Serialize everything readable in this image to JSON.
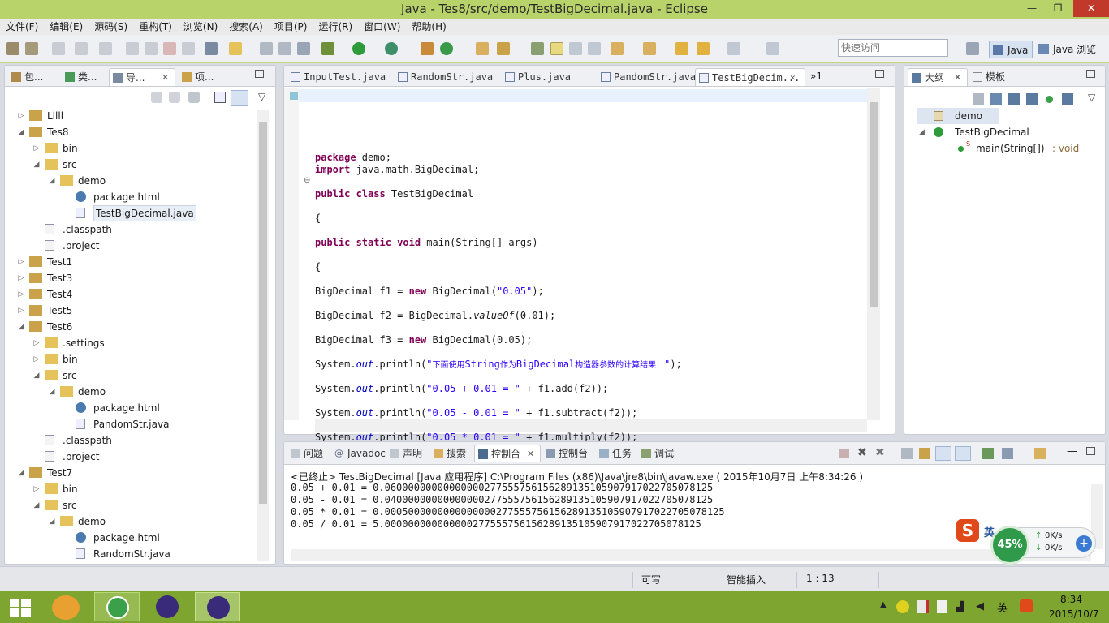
{
  "window": {
    "title": "Java - Tes8/src/demo/TestBigDecimal.java - Eclipse",
    "min": "—",
    "max": "❐",
    "close": "✕"
  },
  "menu": [
    "文件(F)",
    "编辑(E)",
    "源码(S)",
    "重构(T)",
    "浏览(N)",
    "搜索(A)",
    "项目(P)",
    "运行(R)",
    "窗口(W)",
    "帮助(H)"
  ],
  "quick_access": {
    "placeholder": "快速访问"
  },
  "perspectives": {
    "java": "Java",
    "browse": "Java 浏览"
  },
  "left_tabs": [
    "包...",
    "类...",
    "导...",
    "项..."
  ],
  "tree": [
    {
      "label": "Lllll",
      "depth": 0,
      "tw": "▷",
      "icon": "project"
    },
    {
      "label": "Tes8",
      "depth": 0,
      "tw": "◢",
      "icon": "project"
    },
    {
      "label": "bin",
      "depth": 1,
      "tw": "▷",
      "icon": "folder"
    },
    {
      "label": "src",
      "depth": 1,
      "tw": "◢",
      "icon": "folder"
    },
    {
      "label": "demo",
      "depth": 2,
      "tw": "◢",
      "icon": "folder"
    },
    {
      "label": "package.html",
      "depth": 3,
      "tw": "",
      "icon": "html"
    },
    {
      "label": "TestBigDecimal.java",
      "depth": 3,
      "tw": "",
      "icon": "java",
      "selected": true
    },
    {
      "label": ".classpath",
      "depth": 1,
      "tw": "",
      "icon": "file"
    },
    {
      "label": ".project",
      "depth": 1,
      "tw": "",
      "icon": "file"
    },
    {
      "label": "Test1",
      "depth": 0,
      "tw": "▷",
      "icon": "project"
    },
    {
      "label": "Test3",
      "depth": 0,
      "tw": "▷",
      "icon": "project"
    },
    {
      "label": "Test4",
      "depth": 0,
      "tw": "▷",
      "icon": "project"
    },
    {
      "label": "Test5",
      "depth": 0,
      "tw": "▷",
      "icon": "project"
    },
    {
      "label": "Test6",
      "depth": 0,
      "tw": "◢",
      "icon": "project"
    },
    {
      "label": ".settings",
      "depth": 1,
      "tw": "▷",
      "icon": "folder"
    },
    {
      "label": "bin",
      "depth": 1,
      "tw": "▷",
      "icon": "folder"
    },
    {
      "label": "src",
      "depth": 1,
      "tw": "◢",
      "icon": "folder"
    },
    {
      "label": "demo",
      "depth": 2,
      "tw": "◢",
      "icon": "folder"
    },
    {
      "label": "package.html",
      "depth": 3,
      "tw": "",
      "icon": "html"
    },
    {
      "label": "PandomStr.java",
      "depth": 3,
      "tw": "",
      "icon": "java"
    },
    {
      "label": ".classpath",
      "depth": 1,
      "tw": "",
      "icon": "file"
    },
    {
      "label": ".project",
      "depth": 1,
      "tw": "",
      "icon": "file"
    },
    {
      "label": "Test7",
      "depth": 0,
      "tw": "◢",
      "icon": "project"
    },
    {
      "label": "bin",
      "depth": 1,
      "tw": "▷",
      "icon": "folder"
    },
    {
      "label": "src",
      "depth": 1,
      "tw": "◢",
      "icon": "folder"
    },
    {
      "label": "demo",
      "depth": 2,
      "tw": "◢",
      "icon": "folder"
    },
    {
      "label": "package.html",
      "depth": 3,
      "tw": "",
      "icon": "html"
    },
    {
      "label": "RandomStr.java",
      "depth": 3,
      "tw": "",
      "icon": "java"
    }
  ],
  "editor_tabs": [
    "InputTest.java",
    "RandomStr.java",
    "Plus.java",
    "PandomStr.java",
    "TestBigDecim..."
  ],
  "editor_overflow": "»1",
  "code": [
    [
      {
        "t": "package ",
        "c": "kw"
      },
      {
        "t": "demo;",
        "c": ""
      }
    ],
    [
      {
        "t": "import ",
        "c": "kw"
      },
      {
        "t": "java.math.BigDecimal;",
        "c": ""
      }
    ],
    [],
    [
      {
        "t": "public class ",
        "c": "kw"
      },
      {
        "t": "TestBigDecimal",
        "c": ""
      }
    ],
    [],
    [
      {
        "t": "{",
        "c": ""
      }
    ],
    [],
    [
      {
        "t": "public static void ",
        "c": "kw"
      },
      {
        "t": "main(String[] args)",
        "c": ""
      }
    ],
    [],
    [
      {
        "t": "{",
        "c": ""
      }
    ],
    [],
    [
      {
        "t": "BigDecimal f1 = ",
        "c": ""
      },
      {
        "t": "new ",
        "c": "kw"
      },
      {
        "t": "BigDecimal(",
        "c": ""
      },
      {
        "t": "\"0.05\"",
        "c": "str"
      },
      {
        "t": ");",
        "c": ""
      }
    ],
    [],
    [
      {
        "t": "BigDecimal f2 = BigDecimal.",
        "c": ""
      },
      {
        "t": "valueOf",
        "c": "it"
      },
      {
        "t": "(0.01);",
        "c": ""
      }
    ],
    [],
    [
      {
        "t": "BigDecimal f3 = ",
        "c": ""
      },
      {
        "t": "new ",
        "c": "kw"
      },
      {
        "t": "BigDecimal(0.05);",
        "c": ""
      }
    ],
    [],
    [
      {
        "t": "System.",
        "c": ""
      },
      {
        "t": "out",
        "c": "fld"
      },
      {
        "t": ".println(",
        "c": ""
      },
      {
        "t": "\"",
        "c": "str"
      },
      {
        "t": "下面使用",
        "c": "str cn-s"
      },
      {
        "t": "String",
        "c": "str"
      },
      {
        "t": "作为",
        "c": "str cn-s"
      },
      {
        "t": "BigDecimal",
        "c": "str"
      },
      {
        "t": "构造器参数的计算结果：",
        "c": "str cn-s"
      },
      {
        "t": "\"",
        "c": "str"
      },
      {
        "t": ");",
        "c": ""
      }
    ],
    [],
    [
      {
        "t": "System.",
        "c": ""
      },
      {
        "t": "out",
        "c": "fld"
      },
      {
        "t": ".println(",
        "c": ""
      },
      {
        "t": "\"0.05 + 0.01 = \"",
        "c": "str"
      },
      {
        "t": " + f1.add(f2));",
        "c": ""
      }
    ],
    [],
    [
      {
        "t": "System.",
        "c": ""
      },
      {
        "t": "out",
        "c": "fld"
      },
      {
        "t": ".println(",
        "c": ""
      },
      {
        "t": "\"0.05 - 0.01 = \"",
        "c": "str"
      },
      {
        "t": " + f1.subtract(f2));",
        "c": ""
      }
    ],
    [],
    [
      {
        "t": "System.",
        "c": ""
      },
      {
        "t": "out",
        "c": "fld"
      },
      {
        "t": ".println(",
        "c": ""
      },
      {
        "t": "\"0.05 * 0.01 = \"",
        "c": "str"
      },
      {
        "t": " + f1.multiply(f2));",
        "c": ""
      }
    ],
    [],
    [
      {
        "t": "System.",
        "c": ""
      },
      {
        "t": "out",
        "c": "fld"
      },
      {
        "t": ".println(",
        "c": ""
      },
      {
        "t": "\"0.05 / 0.01 = \"",
        "c": "str"
      },
      {
        "t": " + f1.divide(f2));",
        "c": ""
      }
    ]
  ],
  "outline_tabs": [
    "大纲",
    "模板"
  ],
  "outline": {
    "package": "demo",
    "class": "TestBigDecimal",
    "method": "main(String[])",
    "method_type": " : void"
  },
  "console_tabs": [
    "问题",
    "Javadoc",
    "声明",
    "搜索",
    "控制台",
    "控制台",
    "任务",
    "调试"
  ],
  "console_header": "<已终止> TestBigDecimal [Java 应用程序] C:\\Program Files (x86)\\Java\\jre8\\bin\\javaw.exe ( 2015年10月7日 上午8:34:26 )",
  "console_lines": [
    "0.05 + 0.01 = 0.06000000000000000277555756156289135105907917022705078125",
    "0.05 - 0.01 = 0.04000000000000000277555756156289135105907917022705078125",
    "0.05 * 0.01 = 0.0005000000000000000277555756156289135105907917022705078125",
    "0.05 / 0.01 = 5.000000000000000277555756156289135105907917022705078125"
  ],
  "status": {
    "writable": "可写",
    "insert": "智能插入",
    "position": "1 : 13"
  },
  "widget": {
    "percent": "45%",
    "up": "0K/s",
    "down": "0K/s",
    "ime": "英"
  },
  "taskbar": {
    "time": "8:34",
    "date": "2015/10/7",
    "ime": "英"
  }
}
